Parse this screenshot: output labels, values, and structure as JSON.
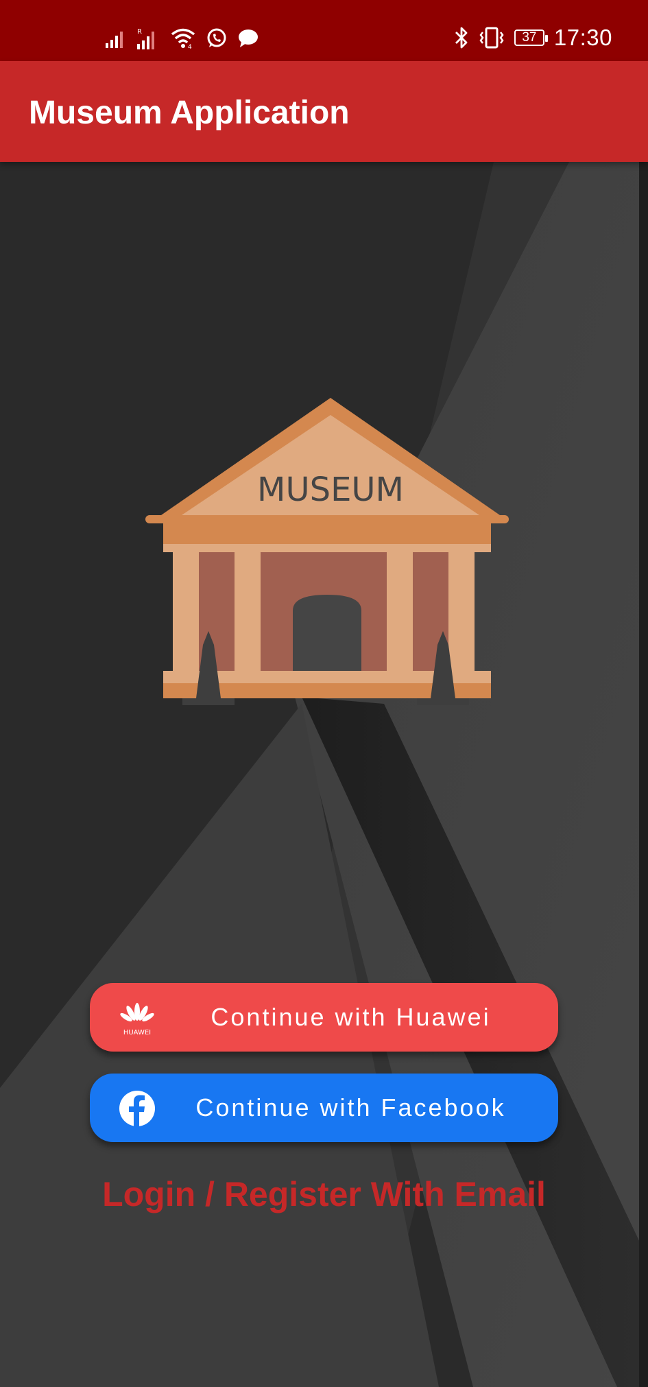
{
  "status_bar": {
    "time": "17:30",
    "battery_level": "37",
    "icons": [
      "signal-icon",
      "roaming-signal-icon",
      "wifi-icon",
      "whatsapp-icon",
      "message-icon",
      "bluetooth-icon",
      "vibrate-icon",
      "battery-icon"
    ]
  },
  "app_bar": {
    "title": "Museum Application"
  },
  "illustration": {
    "sign_text": "MUSEUM"
  },
  "buttons": {
    "huawei_label": "Continue with Huawei",
    "huawei_logo_text": "HUAWEI",
    "facebook_label": "Continue with Facebook",
    "email_link": "Login / Register With Email"
  },
  "colors": {
    "status_bar": "#8f0000",
    "app_bar": "#c62828",
    "huawei_button": "#ef4a4a",
    "facebook_button": "#1877f2",
    "email_link": "#c62828",
    "background": "#2a2a2a"
  }
}
